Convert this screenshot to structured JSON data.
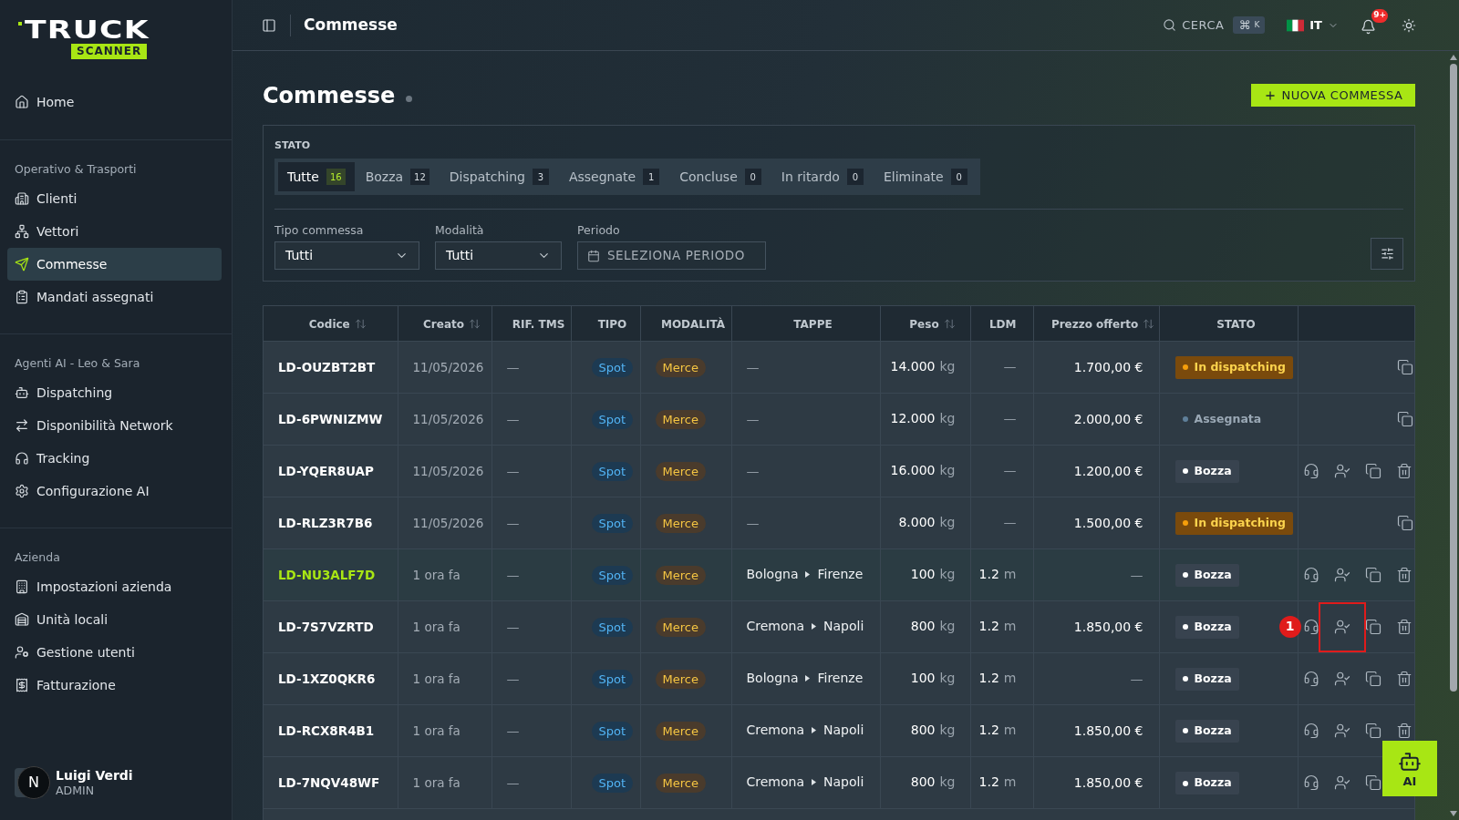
{
  "sidebar": {
    "logo": {
      "wordmark": "TRUCK",
      "tag": "SCANNER"
    },
    "sections": [
      {
        "items": [
          {
            "label": "Home",
            "kind": "home",
            "selected": false
          }
        ]
      },
      {
        "title": "Operativo & Trasporti",
        "items": [
          {
            "label": "Clienti",
            "kind": "clients",
            "selected": false
          },
          {
            "label": "Vettori",
            "kind": "carriers",
            "selected": false
          },
          {
            "label": "Commesse",
            "kind": "orders",
            "selected": true
          },
          {
            "label": "Mandati assegnati",
            "kind": "mandates",
            "selected": false
          }
        ]
      },
      {
        "title": "Agenti AI - Leo & Sara",
        "items": [
          {
            "label": "Dispatching",
            "kind": "bot",
            "selected": false
          },
          {
            "label": "Disponibilità Network",
            "kind": "exchange",
            "selected": false
          },
          {
            "label": "Tracking",
            "kind": "headphones",
            "selected": false
          },
          {
            "label": "Configurazione AI",
            "kind": "settings",
            "selected": false
          }
        ]
      },
      {
        "title": "Azienda",
        "items": [
          {
            "label": "Impostazioni azienda",
            "kind": "company",
            "selected": false
          },
          {
            "label": "Unità locali",
            "kind": "warehouse",
            "selected": false
          },
          {
            "label": "Gestione utenti",
            "kind": "users",
            "selected": false
          },
          {
            "label": "Fatturazione",
            "kind": "billing",
            "selected": false
          }
        ]
      }
    ],
    "user": {
      "name": "Luigi Verdi",
      "role": "ADMIN",
      "dev_badge": "N"
    }
  },
  "topbar": {
    "title": "Commesse",
    "search": {
      "label": "CERCA",
      "shortcut": [
        "⌘",
        "K"
      ]
    },
    "language": "IT",
    "notifications": "9+"
  },
  "page": {
    "title": "Commesse",
    "new_button": "NUOVA COMMESSA"
  },
  "filters": {
    "status_label": "STATO",
    "status_tabs": [
      {
        "label": "Tutte",
        "count": "16",
        "selected": true
      },
      {
        "label": "Bozza",
        "count": "12",
        "selected": false
      },
      {
        "label": "Dispatching",
        "count": "3",
        "selected": false
      },
      {
        "label": "Assegnate",
        "count": "1",
        "selected": false
      },
      {
        "label": "Concluse",
        "count": "0",
        "selected": false
      },
      {
        "label": "In ritardo",
        "count": "0",
        "selected": false
      },
      {
        "label": "Eliminate",
        "count": "0",
        "selected": false
      }
    ],
    "fields": [
      {
        "label": "Tipo commessa",
        "kind": "select",
        "value": "Tutti"
      },
      {
        "label": "Modalità",
        "kind": "select",
        "value": "Tutti"
      },
      {
        "label": "Periodo",
        "kind": "date",
        "placeholder": "SELEZIONA PERIODO"
      }
    ]
  },
  "table": {
    "columns": [
      {
        "label": "Codice",
        "sortable": true
      },
      {
        "label": "Creato",
        "sortable": true
      },
      {
        "label": "RIF. TMS",
        "sortable": false
      },
      {
        "label": "TIPO",
        "sortable": false
      },
      {
        "label": "MODALITÀ",
        "sortable": false
      },
      {
        "label": "TAPPE",
        "sortable": false
      },
      {
        "label": "Peso",
        "sortable": true
      },
      {
        "label": "LDM",
        "sortable": false
      },
      {
        "label": "Prezzo offerto",
        "sortable": true
      },
      {
        "label": "STATO",
        "sortable": false
      }
    ],
    "rows": [
      {
        "code": "LD-OUZBT2BT",
        "highlighted": false,
        "created": "11/05/2026",
        "tms_ref": "—",
        "type": "Spot",
        "mode": "Merce",
        "stops_text": "—",
        "weight": "14.000",
        "weight_unit": "kg",
        "ldm": "—",
        "price": "1.700,00 €",
        "status": {
          "label": "In dispatching",
          "kind": "dispatching"
        },
        "actions": [
          {
            "kind": "copy"
          }
        ]
      },
      {
        "code": "LD-6PWNIZMW",
        "highlighted": false,
        "created": "11/05/2026",
        "tms_ref": "—",
        "type": "Spot",
        "mode": "Merce",
        "stops_text": "—",
        "weight": "12.000",
        "weight_unit": "kg",
        "ldm": "—",
        "price": "2.000,00 €",
        "status": {
          "label": "Assegnata",
          "kind": "assigned"
        },
        "actions": [
          {
            "kind": "copy"
          }
        ]
      },
      {
        "code": "LD-YQER8UAP",
        "highlighted": false,
        "created": "11/05/2026",
        "tms_ref": "—",
        "type": "Spot",
        "mode": "Merce",
        "stops_text": "—",
        "weight": "16.000",
        "weight_unit": "kg",
        "ldm": "—",
        "price": "1.200,00 €",
        "status": {
          "label": "Bozza",
          "kind": "draft"
        },
        "actions": [
          {
            "kind": "dispatch"
          },
          {
            "kind": "assign"
          },
          {
            "kind": "copy"
          },
          {
            "kind": "delete"
          }
        ]
      },
      {
        "code": "LD-RLZ3R7B6",
        "highlighted": false,
        "created": "11/05/2026",
        "tms_ref": "—",
        "type": "Spot",
        "mode": "Merce",
        "stops_text": "—",
        "weight": "8.000",
        "weight_unit": "kg",
        "ldm": "—",
        "price": "1.500,00 €",
        "status": {
          "label": "In dispatching",
          "kind": "dispatching"
        },
        "actions": [
          {
            "kind": "copy"
          }
        ]
      },
      {
        "code": "LD-NU3ALF7D",
        "highlighted": true,
        "created": "1 ora fa",
        "tms_ref": "—",
        "type": "Spot",
        "mode": "Merce",
        "stops": [
          "Bologna",
          "Firenze"
        ],
        "weight": "100",
        "weight_unit": "kg",
        "ldm": "1.2",
        "ldm_unit": "m",
        "price": "—",
        "status": {
          "label": "Bozza",
          "kind": "draft"
        },
        "actions": [
          {
            "kind": "dispatch"
          },
          {
            "kind": "assign"
          },
          {
            "kind": "copy"
          },
          {
            "kind": "delete"
          }
        ]
      },
      {
        "code": "LD-7S7VZRTD",
        "highlighted": false,
        "created": "1 ora fa",
        "tms_ref": "—",
        "type": "Spot",
        "mode": "Merce",
        "stops": [
          "Cremona",
          "Napoli"
        ],
        "weight": "800",
        "weight_unit": "kg",
        "ldm": "1.2",
        "ldm_unit": "m",
        "price": "1.850,00 €",
        "status": {
          "label": "Bozza",
          "kind": "draft"
        },
        "actions": [
          {
            "kind": "dispatch"
          },
          {
            "kind": "assign",
            "annotation": "1"
          },
          {
            "kind": "copy"
          },
          {
            "kind": "delete"
          }
        ]
      },
      {
        "code": "LD-1XZ0QKR6",
        "highlighted": false,
        "created": "1 ora fa",
        "tms_ref": "—",
        "type": "Spot",
        "mode": "Merce",
        "stops": [
          "Bologna",
          "Firenze"
        ],
        "weight": "100",
        "weight_unit": "kg",
        "ldm": "1.2",
        "ldm_unit": "m",
        "price": "—",
        "status": {
          "label": "Bozza",
          "kind": "draft"
        },
        "actions": [
          {
            "kind": "dispatch"
          },
          {
            "kind": "assign"
          },
          {
            "kind": "copy"
          },
          {
            "kind": "delete"
          }
        ]
      },
      {
        "code": "LD-RCX8R4B1",
        "highlighted": false,
        "created": "1 ora fa",
        "tms_ref": "—",
        "type": "Spot",
        "mode": "Merce",
        "stops": [
          "Cremona",
          "Napoli"
        ],
        "weight": "800",
        "weight_unit": "kg",
        "ldm": "1.2",
        "ldm_unit": "m",
        "price": "1.850,00 €",
        "status": {
          "label": "Bozza",
          "kind": "draft"
        },
        "actions": [
          {
            "kind": "dispatch"
          },
          {
            "kind": "assign"
          },
          {
            "kind": "copy"
          },
          {
            "kind": "delete"
          }
        ]
      },
      {
        "code": "LD-7NQV48WF",
        "highlighted": false,
        "created": "1 ora fa",
        "tms_ref": "—",
        "type": "Spot",
        "mode": "Merce",
        "stops": [
          "Cremona",
          "Napoli"
        ],
        "weight": "800",
        "weight_unit": "kg",
        "ldm": "1.2",
        "ldm_unit": "m",
        "price": "1.850,00 €",
        "status": {
          "label": "Bozza",
          "kind": "draft"
        },
        "actions": [
          {
            "kind": "dispatch"
          },
          {
            "kind": "assign"
          },
          {
            "kind": "copy"
          }
        ]
      }
    ]
  },
  "assistant_button": "AI"
}
